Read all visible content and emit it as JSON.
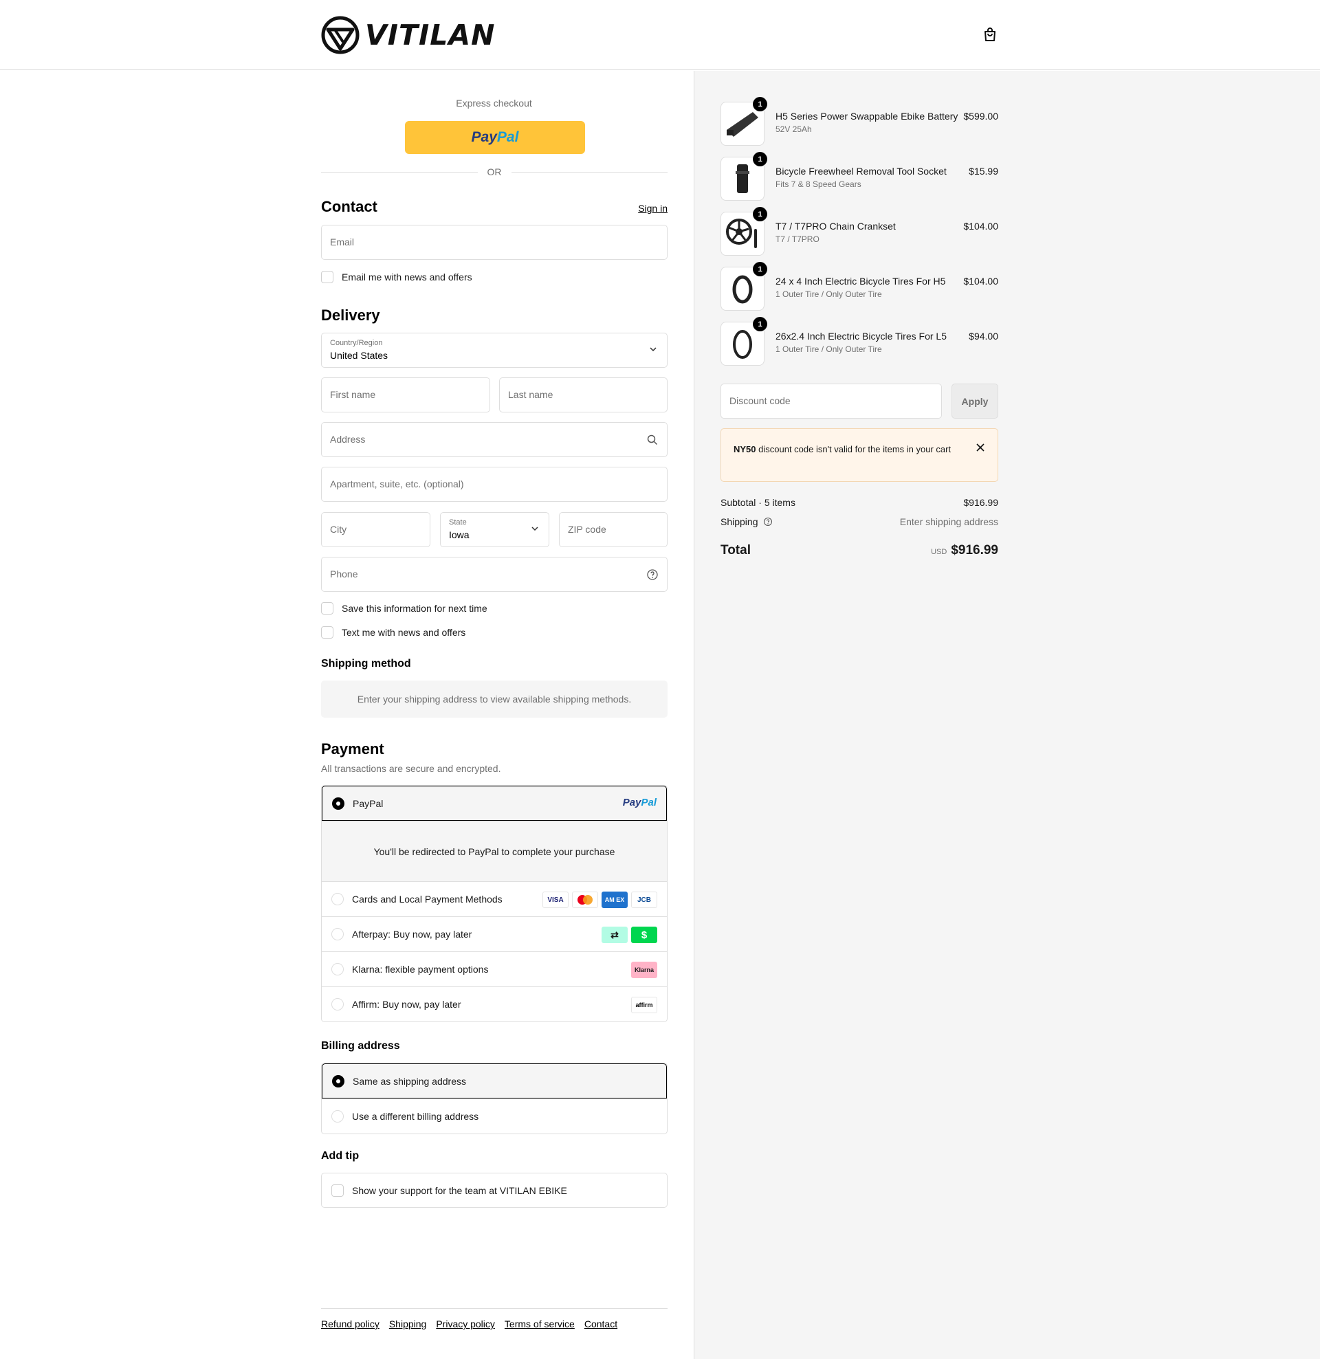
{
  "brand": {
    "name": "VITILAN"
  },
  "express": {
    "label": "Express checkout",
    "paypal_a": "Pay",
    "paypal_b": "Pal",
    "or": "OR"
  },
  "contact": {
    "title": "Contact",
    "sign_in": "Sign in",
    "email_placeholder": "Email",
    "news_checkbox": "Email me with news and offers"
  },
  "delivery": {
    "title": "Delivery",
    "country_label": "Country/Region",
    "country_value": "United States",
    "first_name": "First name",
    "last_name": "Last name",
    "address": "Address",
    "apartment": "Apartment, suite, etc. (optional)",
    "city": "City",
    "state_label": "State",
    "state_value": "Iowa",
    "zip": "ZIP code",
    "phone": "Phone",
    "save_info": "Save this information for next time",
    "text_me": "Text me with news and offers"
  },
  "shipping_method": {
    "title": "Shipping method",
    "message": "Enter your shipping address to view available shipping methods."
  },
  "payment": {
    "title": "Payment",
    "subtitle": "All transactions are secure and encrypted.",
    "options": [
      {
        "label": "PayPal",
        "selected": true
      },
      {
        "label": "Cards and Local Payment Methods"
      },
      {
        "label": "Afterpay: Buy now, pay later"
      },
      {
        "label": "Klarna: flexible payment options"
      },
      {
        "label": "Affirm: Buy now, pay later"
      }
    ],
    "paypal_detail": "You'll be redirected to PayPal to complete your purchase",
    "card_logos": [
      "VISA",
      "",
      "AM EX",
      "JCB"
    ],
    "klarna_logo": "Klarna",
    "affirm_logo": "affirm"
  },
  "billing": {
    "title": "Billing address",
    "options": [
      {
        "label": "Same as shipping address",
        "selected": true
      },
      {
        "label": "Use a different billing address"
      }
    ]
  },
  "tip": {
    "title": "Add tip",
    "label": "Show your support for the team at VITILAN EBIKE"
  },
  "footer": {
    "links": [
      "Refund policy",
      "Shipping",
      "Privacy policy",
      "Terms of service",
      "Contact"
    ]
  },
  "cart": {
    "items": [
      {
        "qty": "1",
        "name": "H5 Series Power Swappable Ebike Battery",
        "variant": "52V 25Ah",
        "price": "$599.00",
        "icon": "battery-icon"
      },
      {
        "qty": "1",
        "name": "Bicycle Freewheel Removal Tool Socket",
        "variant": "Fits 7 & 8 Speed Gears",
        "price": "$15.99",
        "icon": "tool-socket-icon"
      },
      {
        "qty": "1",
        "name": "T7 / T7PRO Chain Crankset",
        "variant": "T7 / T7PRO",
        "price": "$104.00",
        "icon": "crankset-icon"
      },
      {
        "qty": "1",
        "name": "24 x 4 Inch Electric Bicycle Tires For H5",
        "variant": "1 Outer Tire / Only Outer Tire",
        "price": "$104.00",
        "icon": "tire-icon"
      },
      {
        "qty": "1",
        "name": "26x2.4 Inch Electric Bicycle Tires For L5",
        "variant": "1 Outer Tire / Only Outer Tire",
        "price": "$94.00",
        "icon": "tire-icon"
      }
    ],
    "discount_placeholder": "Discount code",
    "apply": "Apply",
    "alert_code": "NY50",
    "alert_text": " discount code isn't valid for the items in your cart",
    "subtotal_label": "Subtotal · 5 items",
    "subtotal_value": "$916.99",
    "shipping_label": "Shipping",
    "shipping_value": "Enter shipping address",
    "total_label": "Total",
    "currency": "USD",
    "total_value": "$916.99"
  }
}
